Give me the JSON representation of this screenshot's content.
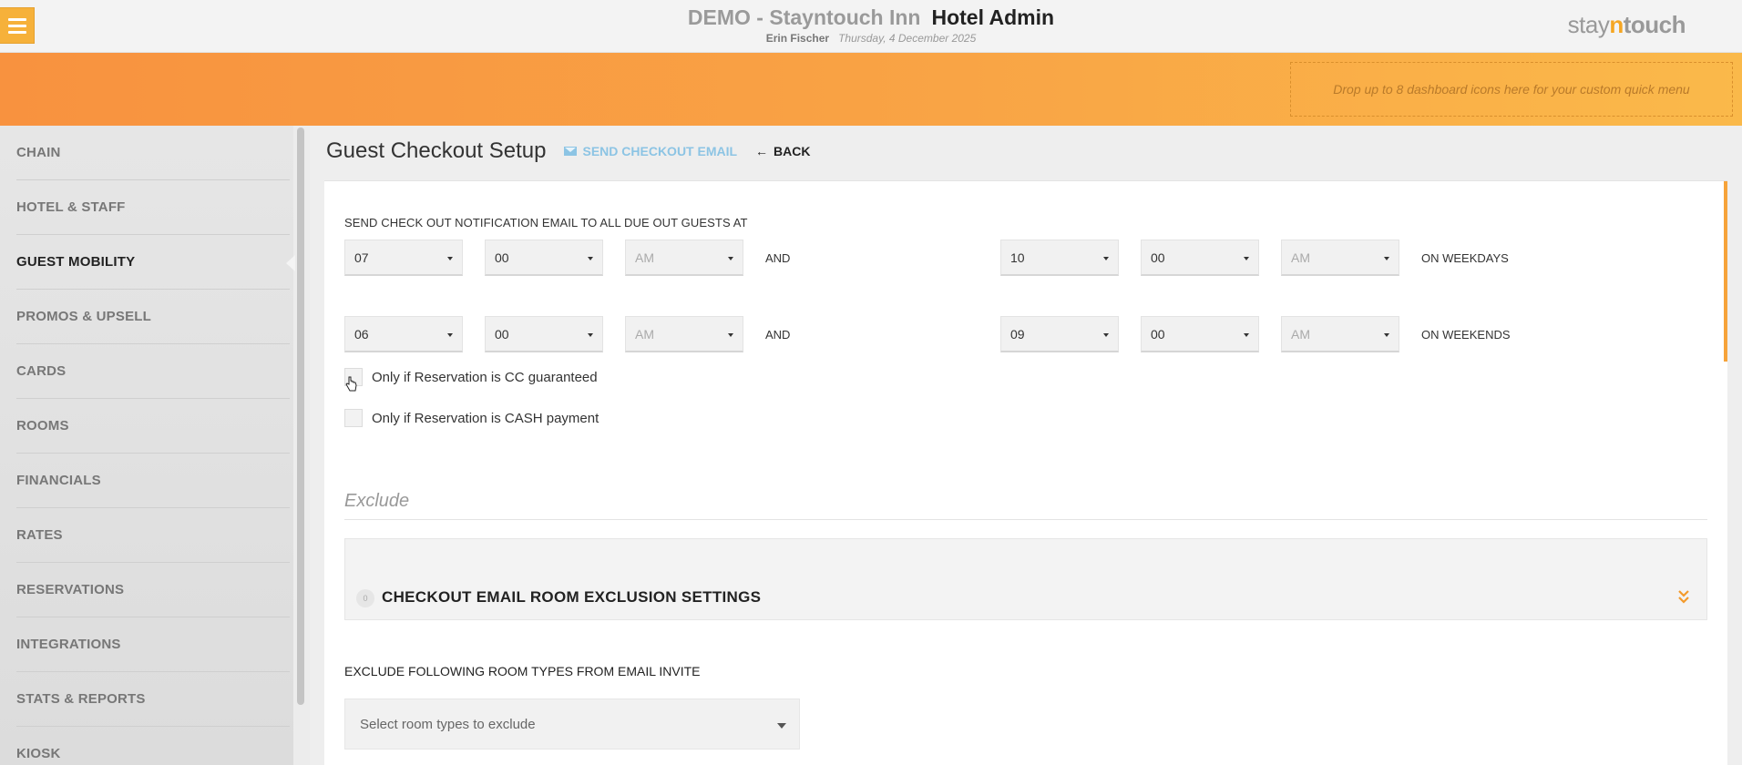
{
  "header": {
    "hotel_name": "DEMO - Stayntouch Inn",
    "app_name": "Hotel Admin",
    "user_name": "Erin Fischer",
    "date": "Thursday, 4 December 2025",
    "logo_prefix": "stay",
    "logo_n": "n",
    "logo_suffix": "touch",
    "menu_icon": "hamburger-menu-icon"
  },
  "quick_menu": {
    "placeholder": "Drop up to 8 dashboard icons here for your custom quick menu"
  },
  "sidebar": {
    "items": [
      {
        "label": "CHAIN"
      },
      {
        "label": "HOTEL & STAFF"
      },
      {
        "label": "GUEST MOBILITY"
      },
      {
        "label": "PROMOS & UPSELL"
      },
      {
        "label": "CARDS"
      },
      {
        "label": "ROOMS"
      },
      {
        "label": "FINANCIALS"
      },
      {
        "label": "RATES"
      },
      {
        "label": "RESERVATIONS"
      },
      {
        "label": "INTEGRATIONS"
      },
      {
        "label": "STATS & REPORTS"
      },
      {
        "label": "KIOSK"
      }
    ],
    "active": "GUEST MOBILITY"
  },
  "page": {
    "title": "Guest Checkout Setup",
    "send_email": "SEND CHECKOUT EMAIL",
    "back": "BACK"
  },
  "schedule": {
    "label": "SEND CHECK OUT NOTIFICATION EMAIL TO ALL DUE OUT GUESTS AT",
    "and_label": "AND",
    "weekdays": {
      "start_hour": "07",
      "start_min": "00",
      "start_ampm": "AM",
      "end_hour": "10",
      "end_min": "00",
      "end_ampm": "AM",
      "label": "ON WEEKDAYS"
    },
    "weekends": {
      "start_hour": "06",
      "start_min": "00",
      "start_ampm": "AM",
      "end_hour": "09",
      "end_min": "00",
      "end_ampm": "AM",
      "label": "ON WEEKENDS"
    }
  },
  "options": {
    "cc_guaranteed": "Only if Reservation is CC guaranteed",
    "cash_payment": "Only if Reservation is CASH payment"
  },
  "exclude": {
    "heading": "Exclude",
    "accordion_count": "0",
    "accordion_title": "CHECKOUT EMAIL ROOM EXCLUSION SETTINGS",
    "room_types_label": "EXCLUDE FOLLOWING ROOM TYPES FROM EMAIL INVITE",
    "room_types_placeholder": "Select room types to exclude"
  },
  "colors": {
    "accent_orange": "#f6b13a",
    "link_blue": "#8cc4e4"
  }
}
